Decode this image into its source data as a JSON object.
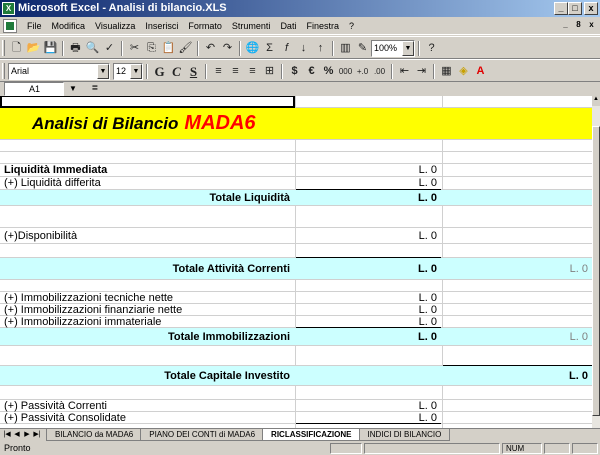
{
  "window": {
    "title": "Microsoft Excel - Analisi di bilancio.XLS"
  },
  "window_buttons": [
    "_",
    "□",
    "x"
  ],
  "doc_buttons": [
    "_",
    "8",
    "x"
  ],
  "menu": [
    "File",
    "Modifica",
    "Visualizza",
    "Inserisci",
    "Formato",
    "Strumenti",
    "Dati",
    "Finestra",
    "?"
  ],
  "toolbar": {
    "zoom": "100%",
    "font": "Arial",
    "size": "12",
    "bold": "G",
    "italic": "C",
    "underline": "S",
    "currency": "$",
    "euro": "€",
    "percent": "%",
    "thousands": "000"
  },
  "formula": {
    "cell": "A1",
    "eq": "=",
    "value": ""
  },
  "sheet": {
    "title_main": "Analisi di Bilancio",
    "title_brand": "MADA6",
    "rows": [
      {
        "label": "Liquidità Immediata",
        "value": "L. 0"
      },
      {
        "label": "(+) Liquidità differita",
        "value": "L. 0"
      },
      {
        "label": "Totale Liquidità",
        "value": "L. 0"
      },
      {
        "label": "(+)Disponibilità",
        "value": "L. 0"
      },
      {
        "label": "Totale Attività Correnti",
        "value": "L. 0",
        "value_c": "L. 0"
      },
      {
        "label": "(+) Immobilizzazioni tecniche nette",
        "value": "L. 0"
      },
      {
        "label": "(+) Immobilizzazioni finanziarie nette",
        "value": "L. 0"
      },
      {
        "label": "(+) Immobilizzazioni immateriale",
        "value": "L. 0"
      },
      {
        "label": "Totale Immobilizzazioni",
        "value": "L. 0",
        "value_c": "L. 0"
      },
      {
        "label": "Totale Capitale Investito",
        "value_c": "L. 0"
      },
      {
        "label": "(+) Passività Correnti",
        "value": "L. 0"
      },
      {
        "label": "(+) Passività Consolidate",
        "value": "L. 0"
      }
    ]
  },
  "tabs": [
    "BILANCIO da MADA6",
    "PIANO DEI CONTI di MADA6",
    "RICLASSIFICAZIONE",
    "INDICI DI BILANCIO"
  ],
  "status": {
    "text": "Pronto",
    "num": "NUM"
  },
  "colors": {
    "title_band": "#ffff00",
    "brand": "#ff0000",
    "totals_band": "#ccffff"
  }
}
